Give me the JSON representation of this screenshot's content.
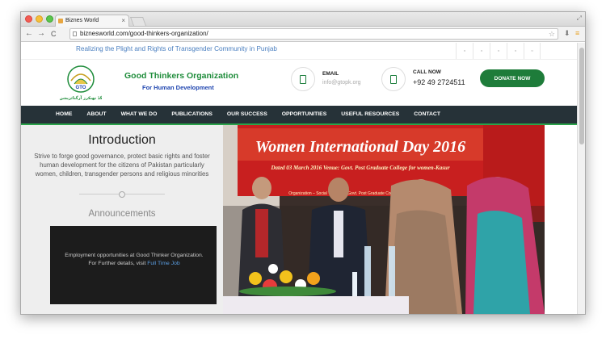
{
  "browser": {
    "tab_title": "Biznes World",
    "tab_close": "×",
    "url": "biznesworld.com/good-thinkers-organization/",
    "back": "←",
    "forward": "→",
    "reload": "C"
  },
  "site": {
    "tagline": "Realizing the Plight and Rights of Transgender Community in Punjab",
    "org_name": "Good Thinkers Organization",
    "org_sub": "For Human Development",
    "email_label": "EMAIL",
    "email_value": "info@gtopk.org",
    "call_label": "CALL NOW",
    "call_value": "+92 49 2724511",
    "donate": "DONATE NOW",
    "nav": [
      "HOME",
      "ABOUT",
      "WHAT WE DO",
      "PUBLICATIONS",
      "OUR SUCCESS",
      "OPPORTUNITIES",
      "USEFUL RESOURCES",
      "CONTACT"
    ],
    "intro_title": "Introduction",
    "intro_text": "Strive to forge good governance, protect basic rights and foster human development for the citizens of Pakistan particularly women, children, transgender persons and religious minorities",
    "announcements_title": "Announcements",
    "announcement_text": "Employment opportunities at Good Thinker Organization. For Further details, visit",
    "announcement_link": "Full Time Job",
    "banner_title": "Women International Day 2016",
    "banner_sub": "Dated 03 March 2016   Venue: Govt. Post Graduate College for women-Kasur",
    "banner_sub2": "Organization – Social Welfare ... Govt. Post Graduate College for Women-Kasur",
    "logo_text": "GTO",
    "logo_urdu": "گڈ تھنکرز آرگنائزیشن"
  }
}
